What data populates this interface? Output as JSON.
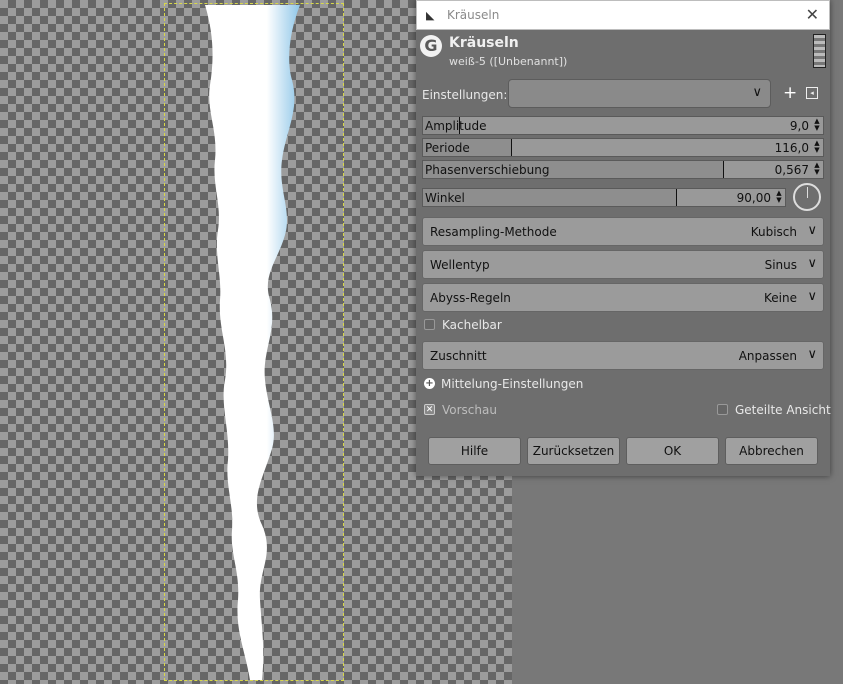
{
  "dialog": {
    "window_title": "Kräuseln",
    "close_glyph": "✕",
    "header_title": "Kräuseln",
    "header_subtitle": "weiß-5 ([Unbenannt])",
    "presets_label": "Einstellungen:",
    "presets_value": "",
    "add_preset_glyph": "+",
    "sliders": [
      {
        "label": "Amplitude",
        "value": "9,0",
        "fraction": 0.09
      },
      {
        "label": "Periode",
        "value": "116,0",
        "fraction": 0.22
      },
      {
        "label": "Phasenverschiebung",
        "value": "0,567",
        "fraction": 0.75
      },
      {
        "label": "Winkel",
        "value": "90,00",
        "fraction": 0.7
      }
    ],
    "combos": [
      {
        "label": "Resampling-Methode",
        "value": "Kubisch"
      },
      {
        "label": "Wellentyp",
        "value": "Sinus"
      },
      {
        "label": "Abyss-Regeln",
        "value": "Keine"
      }
    ],
    "tileable": {
      "label": "Kachelbar",
      "checked": false
    },
    "clipping": {
      "label": "Zuschnitt",
      "value": "Anpassen"
    },
    "blending_expander": {
      "label": "Mittelung-Einstellungen"
    },
    "preview": {
      "label": "Vorschau",
      "checked": true
    },
    "split_view": {
      "label": "Geteilte Ansicht",
      "checked": false
    },
    "buttons": {
      "help": "Hilfe",
      "reset": "Zurücksetzen",
      "ok": "OK",
      "cancel": "Abbrechen"
    }
  },
  "icons": {
    "window": "gimp-wilber-icon",
    "logo": "gimp-logo-icon",
    "close": "close-icon",
    "chevron": "chevron-down-icon",
    "add": "plus-icon",
    "preset_menu": "menu-icon",
    "dial": "angle-dial-icon"
  },
  "colors": {
    "ripple_fill": "#ffffff",
    "ripple_edge": "#8fc6e8",
    "selection_border": "#d8d84a"
  }
}
